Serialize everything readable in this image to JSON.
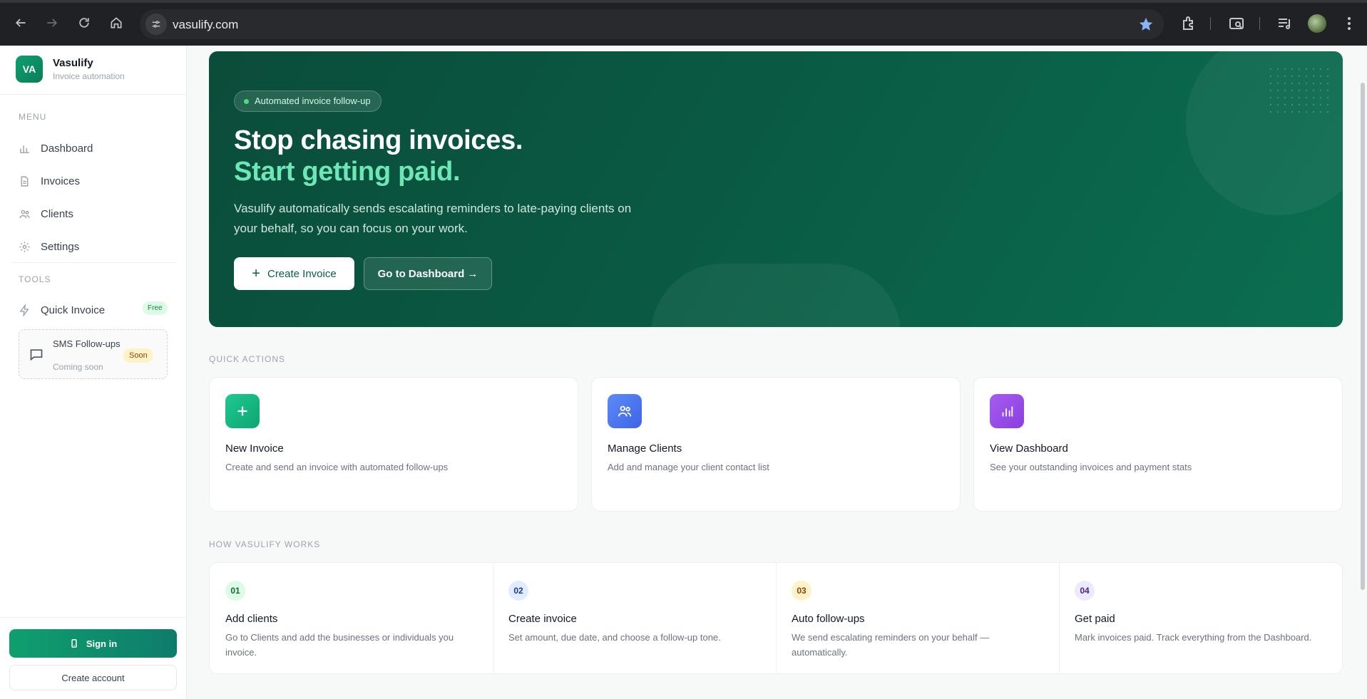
{
  "browser": {
    "url": "vasulify.com"
  },
  "brand": {
    "logo": "VA",
    "name": "Vasulify",
    "tagline": "Invoice automation"
  },
  "sidebar": {
    "menu_label": "MENU",
    "menu": [
      {
        "label": "Dashboard",
        "icon": "bar-chart-icon"
      },
      {
        "label": "Invoices",
        "icon": "document-icon"
      },
      {
        "label": "Clients",
        "icon": "users-icon"
      },
      {
        "label": "Settings",
        "icon": "gear-icon"
      }
    ],
    "tools_label": "TOOLS",
    "quick_invoice": {
      "label": "Quick Invoice",
      "badge": "Free"
    },
    "sms": {
      "title": "SMS Follow-ups",
      "sub": "Coming soon",
      "badge": "Soon"
    },
    "sign_in": "Sign in",
    "create_account": "Create account"
  },
  "hero": {
    "pill": "Automated invoice follow-up",
    "title_line1": "Stop chasing invoices.",
    "title_line2": "Start getting paid.",
    "description": "Vasulify automatically sends escalating reminders to late-paying clients on your behalf, so you can focus on your work.",
    "btn_create": "Create Invoice",
    "btn_dashboard": "Go to Dashboard →"
  },
  "quick_actions": {
    "label": "QUICK ACTIONS",
    "cards": [
      {
        "title": "New Invoice",
        "desc": "Create and send an invoice with automated follow-ups",
        "color": "#10b981"
      },
      {
        "title": "Manage Clients",
        "desc": "Add and manage your client contact list",
        "color": "#4f7cf5"
      },
      {
        "title": "View Dashboard",
        "desc": "See your outstanding invoices and payment stats",
        "color": "#9b4dea"
      }
    ]
  },
  "how": {
    "label": "HOW VASULIFY WORKS",
    "steps": [
      {
        "num": "01",
        "title": "Add clients",
        "desc": "Go to Clients and add the businesses or individuals you invoice.",
        "color": "#dcfce7",
        "text": "#166534"
      },
      {
        "num": "02",
        "title": "Create invoice",
        "desc": "Set amount, due date, and choose a follow-up tone.",
        "color": "#e0ecff",
        "text": "#1e3a8a"
      },
      {
        "num": "03",
        "title": "Auto follow-ups",
        "desc": "We send escalating reminders on your behalf — automatically.",
        "color": "#fef3c7",
        "text": "#92400e"
      },
      {
        "num": "04",
        "title": "Get paid",
        "desc": "Mark invoices paid. Track everything from the Dashboard.",
        "color": "#ede9fe",
        "text": "#4c1d95"
      }
    ]
  }
}
